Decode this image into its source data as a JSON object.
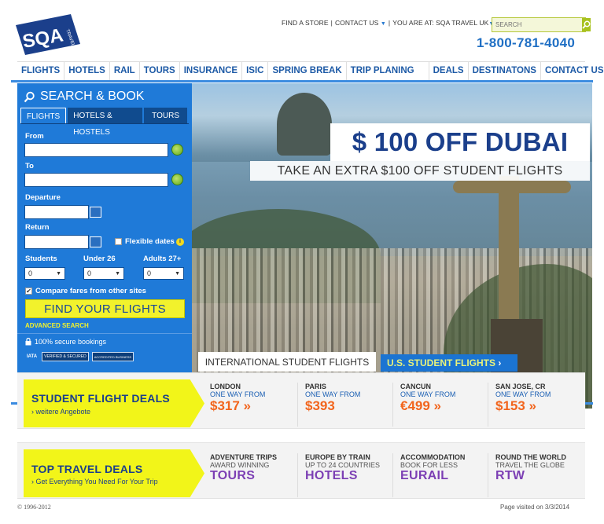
{
  "header": {
    "logo_text": "SQA",
    "logo_subtext": "TRAVEL",
    "top_links": [
      "FIND A STORE",
      "CONTACT US",
      "YOU ARE AT: SQA TRAVEL UK"
    ],
    "search_placeholder": "SEARCH",
    "phone": "1-800-781-4040"
  },
  "nav": [
    "FLIGHTS",
    "HOTELS",
    "RAIL",
    "TOURS",
    "INSURANCE",
    "ISIC",
    "SPRING BREAK",
    "TRIP PLANING",
    "DEALS",
    "DESTINATONS",
    "CONTACT US"
  ],
  "search_panel": {
    "title": "SEARCH & BOOK",
    "tabs": [
      "FLIGHTS",
      "HOTELS & HOSTELS",
      "TOURS"
    ],
    "from_label": "From",
    "to_label": "To",
    "departure_label": "Departure",
    "return_label": "Return",
    "flexible_label": "Flexible dates",
    "students_label": "Students",
    "under26_label": "Under 26",
    "adults_label": "Adults 27+",
    "students_value": "0",
    "under26_value": "0",
    "adults_value": "0",
    "compare_label": "Compare fares from other sites",
    "find_button": "FIND YOUR FLIGHTS",
    "advanced_search": "ADVANCED SEARCH",
    "secure_label": "100% secure bookings",
    "badges": [
      "IATA",
      "VERIFIED & SECURED",
      "ACCREDITED BUSINESS"
    ]
  },
  "hero": {
    "headline": "$ 100 OFF DUBAI",
    "subheadline": "TAKE AN EXTRA $100 OFF STUDENT FLIGHTS",
    "tab_international": "INTERNATIONAL STUDENT FLIGHTS",
    "tab_us": "U.S. STUDENT FLIGHTS"
  },
  "student_deals": {
    "title": "STUDENT FLIGHT DEALS",
    "subtitle": "› weitere Angebote",
    "items": [
      {
        "city": "LONDON",
        "mode": "ONE WAY FROM",
        "price": "$317 »"
      },
      {
        "city": "PARIS",
        "mode": "ONE WAY FROM",
        "price": "$393"
      },
      {
        "city": "CANCUN",
        "mode": "ONE WAY FROM",
        "price": "€499 »"
      },
      {
        "city": "SAN JOSE, CR",
        "mode": "ONE WAY FROM",
        "price": "$153 »"
      }
    ]
  },
  "travel_deals": {
    "title": "TOP TRAVEL DEALS",
    "subtitle": "› Get Everything You Need For Your Trip",
    "items": [
      {
        "heading": "ADVENTURE TRIPS",
        "sub": "AWARD WINNING",
        "big": "TOURS"
      },
      {
        "heading": "EUROPE BY TRAIN",
        "sub": "UP TO 24 COUNTRIES",
        "big": "HOTELS"
      },
      {
        "heading": "ACCOMMODATION",
        "sub": "BOOK FOR LESS",
        "big": "EURAIL"
      },
      {
        "heading": "ROUND THE WORLD",
        "sub": "TRAVEL THE GLOBE",
        "big": "RTW"
      }
    ]
  },
  "footer": {
    "copyright": "© 1996-2012",
    "visited": "Page visited on 3/3/2014"
  },
  "colors": {
    "brand_blue": "#1b3f8b",
    "panel_blue": "#1f7ad8",
    "accent_yellow": "#f2f519",
    "price_orange": "#f2651d",
    "deal_purple": "#7c3fb4"
  }
}
